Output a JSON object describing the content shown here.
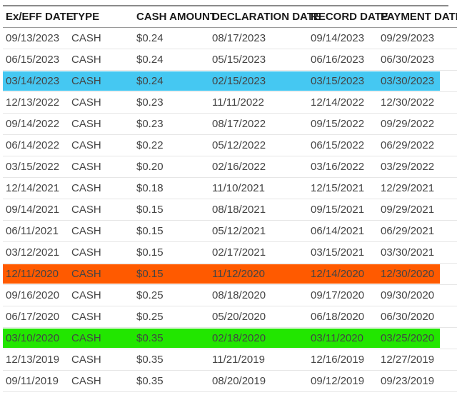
{
  "table": {
    "columns": [
      "Ex/EFF DATE",
      "TYPE",
      "CASH AMOUNT",
      "DECLARATION DATE",
      "RECORD DATE",
      "PAYMENT DATE"
    ],
    "highlight_colors": {
      "blue": "#45c8f2",
      "orange": "#ff5a00",
      "green": "#22e600"
    },
    "rows": [
      {
        "ex_date": "09/13/2023",
        "type": "CASH",
        "amount": "$0.24",
        "declaration": "08/17/2023",
        "record": "09/14/2023",
        "payment": "09/29/2023",
        "highlight": ""
      },
      {
        "ex_date": "06/15/2023",
        "type": "CASH",
        "amount": "$0.24",
        "declaration": "05/15/2023",
        "record": "06/16/2023",
        "payment": "06/30/2023",
        "highlight": ""
      },
      {
        "ex_date": "03/14/2023",
        "type": "CASH",
        "amount": "$0.24",
        "declaration": "02/15/2023",
        "record": "03/15/2023",
        "payment": "03/30/2023",
        "highlight": "#45c8f2"
      },
      {
        "ex_date": "12/13/2022",
        "type": "CASH",
        "amount": "$0.23",
        "declaration": "11/11/2022",
        "record": "12/14/2022",
        "payment": "12/30/2022",
        "highlight": ""
      },
      {
        "ex_date": "09/14/2022",
        "type": "CASH",
        "amount": "$0.23",
        "declaration": "08/17/2022",
        "record": "09/15/2022",
        "payment": "09/29/2022",
        "highlight": ""
      },
      {
        "ex_date": "06/14/2022",
        "type": "CASH",
        "amount": "$0.22",
        "declaration": "05/12/2022",
        "record": "06/15/2022",
        "payment": "06/29/2022",
        "highlight": ""
      },
      {
        "ex_date": "03/15/2022",
        "type": "CASH",
        "amount": "$0.20",
        "declaration": "02/16/2022",
        "record": "03/16/2022",
        "payment": "03/29/2022",
        "highlight": ""
      },
      {
        "ex_date": "12/14/2021",
        "type": "CASH",
        "amount": "$0.18",
        "declaration": "11/10/2021",
        "record": "12/15/2021",
        "payment": "12/29/2021",
        "highlight": ""
      },
      {
        "ex_date": "09/14/2021",
        "type": "CASH",
        "amount": "$0.15",
        "declaration": "08/18/2021",
        "record": "09/15/2021",
        "payment": "09/29/2021",
        "highlight": ""
      },
      {
        "ex_date": "06/11/2021",
        "type": "CASH",
        "amount": "$0.15",
        "declaration": "05/12/2021",
        "record": "06/14/2021",
        "payment": "06/29/2021",
        "highlight": ""
      },
      {
        "ex_date": "03/12/2021",
        "type": "CASH",
        "amount": "$0.15",
        "declaration": "02/17/2021",
        "record": "03/15/2021",
        "payment": "03/30/2021",
        "highlight": ""
      },
      {
        "ex_date": "12/11/2020",
        "type": "CASH",
        "amount": "$0.15",
        "declaration": "11/12/2020",
        "record": "12/14/2020",
        "payment": "12/30/2020",
        "highlight": "#ff5a00"
      },
      {
        "ex_date": "09/16/2020",
        "type": "CASH",
        "amount": "$0.25",
        "declaration": "08/18/2020",
        "record": "09/17/2020",
        "payment": "09/30/2020",
        "highlight": ""
      },
      {
        "ex_date": "06/17/2020",
        "type": "CASH",
        "amount": "$0.25",
        "declaration": "05/20/2020",
        "record": "06/18/2020",
        "payment": "06/30/2020",
        "highlight": ""
      },
      {
        "ex_date": "03/10/2020",
        "type": "CASH",
        "amount": "$0.35",
        "declaration": "02/18/2020",
        "record": "03/11/2020",
        "payment": "03/25/2020",
        "highlight": "#22e600"
      },
      {
        "ex_date": "12/13/2019",
        "type": "CASH",
        "amount": "$0.35",
        "declaration": "11/21/2019",
        "record": "12/16/2019",
        "payment": "12/27/2019",
        "highlight": ""
      },
      {
        "ex_date": "09/11/2019",
        "type": "CASH",
        "amount": "$0.35",
        "declaration": "08/20/2019",
        "record": "09/12/2019",
        "payment": "09/23/2019",
        "highlight": ""
      }
    ]
  }
}
